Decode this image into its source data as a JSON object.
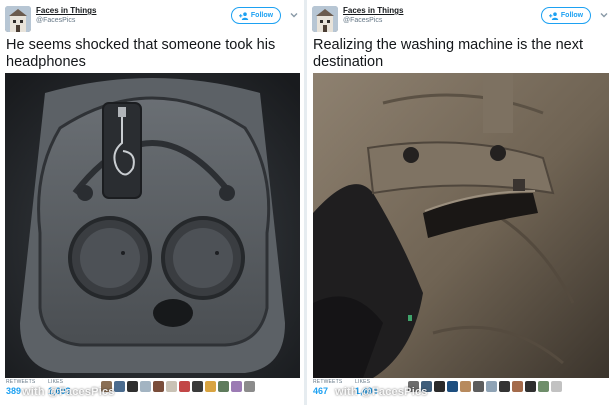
{
  "tweets": [
    {
      "account_name": "Faces in Things",
      "handle": "@FacesPics",
      "follow_label": "Follow",
      "text": "He seems shocked that someone took his headphones",
      "retweets_label": "RETWEETS",
      "likes_label": "LIKES",
      "retweets": "389",
      "likes": "1,603",
      "watermark": "with @FacesPics",
      "photo_icon": "headphone-case-face-photo",
      "likers_count_shown": 12
    },
    {
      "account_name": "Faces in Things",
      "handle": "@FacesPics",
      "follow_label": "Follow",
      "text": "Realizing the washing machine is the next destination",
      "retweets_label": "RETWEETS",
      "likes_label": "LIKES",
      "retweets": "467",
      "likes": "1,494",
      "watermark": "with @FacesPics",
      "photo_icon": "cargo-pants-face-photo",
      "likers_count_shown": 12
    }
  ],
  "colors": {
    "accent": "#1da1f2",
    "text": "#14171a",
    "muted": "#657786"
  }
}
